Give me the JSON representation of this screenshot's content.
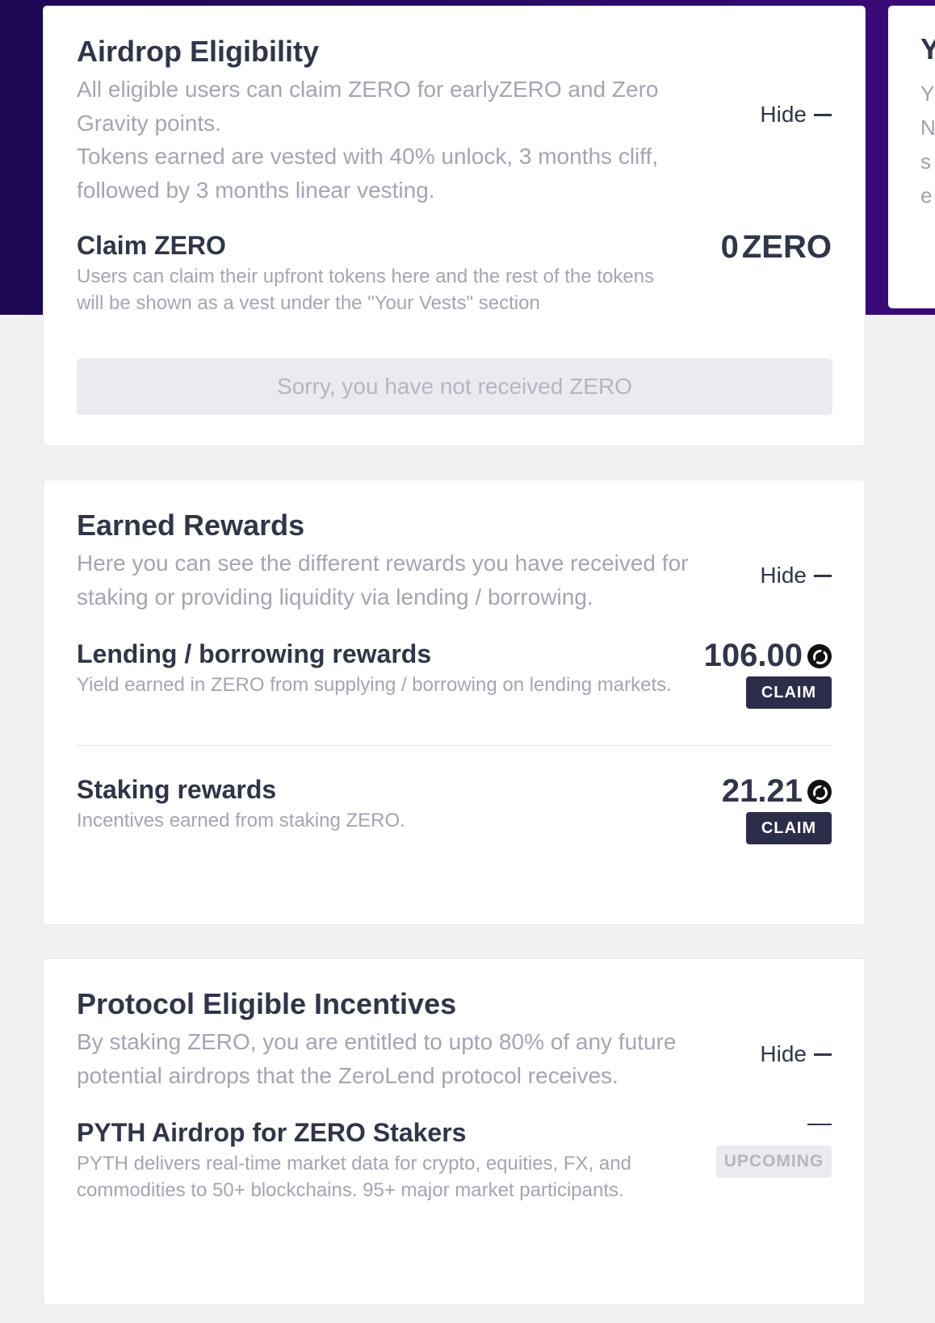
{
  "colors": {
    "hero_background": "#2a0a66",
    "claim_button": "#2b2d4a",
    "text_primary": "#303549",
    "text_muted": "#a3a6b2"
  },
  "peek_card": {
    "title_fragment": "Y",
    "lines": [
      "Y",
      "N",
      "s",
      "e"
    ]
  },
  "airdrop": {
    "title": "Airdrop Eligibility",
    "description": "All eligible users can claim ZERO for earlyZERO and Zero Gravity points.\nTokens earned are vested with 40% unlock, 3 months cliff, followed by 3 months linear vesting.",
    "hide_label": "Hide",
    "claim_title": "Claim ZERO",
    "claim_description": "Users can claim their upfront tokens here and the rest of the tokens will be shown as a vest under the \"Your Vests\" section",
    "claim_amount": "0",
    "claim_unit": "ZERO",
    "status_button": "Sorry, you have not received ZERO"
  },
  "earned": {
    "title": "Earned Rewards",
    "description": "Here you can see the different rewards you have received for staking or providing liquidity via lending / borrowing.",
    "hide_label": "Hide",
    "rows": [
      {
        "title": "Lending / borrowing rewards",
        "description": "Yield earned in ZERO from supplying / borrowing on lending markets.",
        "amount": "106.00",
        "button": "CLAIM"
      },
      {
        "title": "Staking rewards",
        "description": "Incentives earned from staking ZERO.",
        "amount": "21.21",
        "button": "CLAIM"
      }
    ]
  },
  "protocol": {
    "title": "Protocol Eligible Incentives",
    "description": "By staking ZERO, you are entitled to upto 80% of any future potential airdrops that the ZeroLend protocol receives.",
    "hide_label": "Hide",
    "row": {
      "title": "PYTH Airdrop for ZERO Stakers",
      "description": "PYTH delivers real-time market data for crypto, equities, FX, and commodities to 50+ blockchains. 95+ major market participants.",
      "badge": "UPCOMING"
    }
  }
}
